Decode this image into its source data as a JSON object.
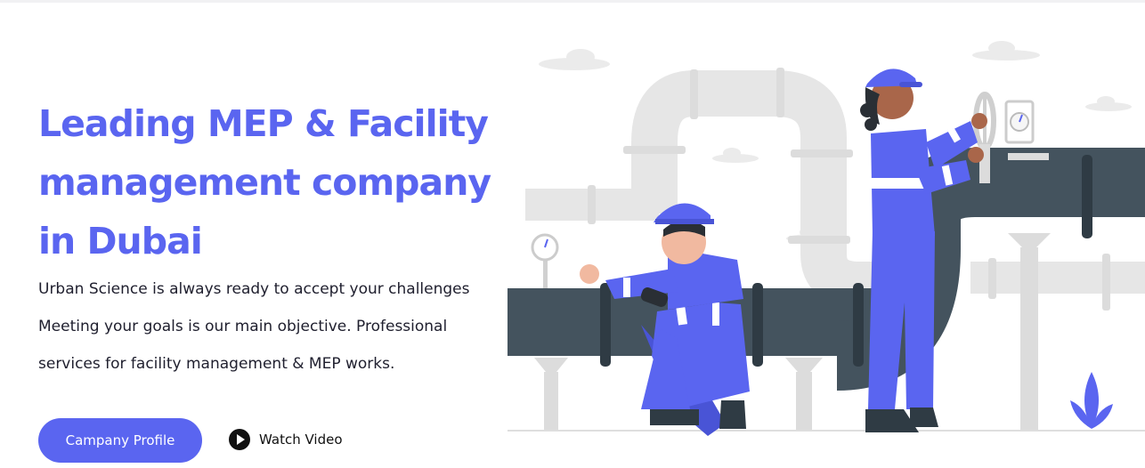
{
  "hero": {
    "title": "Leading MEP & Facility management company in Dubai",
    "lines": [
      "Urban Science is always ready to accept your challenges",
      "Meeting your goals is our main objective. Professional",
      "services for facility management & MEP works."
    ],
    "cta_label": "Campany Profile",
    "watch_label": "Watch Video",
    "watch_icon": "play-circle-icon"
  },
  "colors": {
    "accent": "#5a65f0",
    "worker_blue": "#5a65f0",
    "pipe_dark": "#44535e",
    "pipe_light": "#e6e6e6"
  }
}
